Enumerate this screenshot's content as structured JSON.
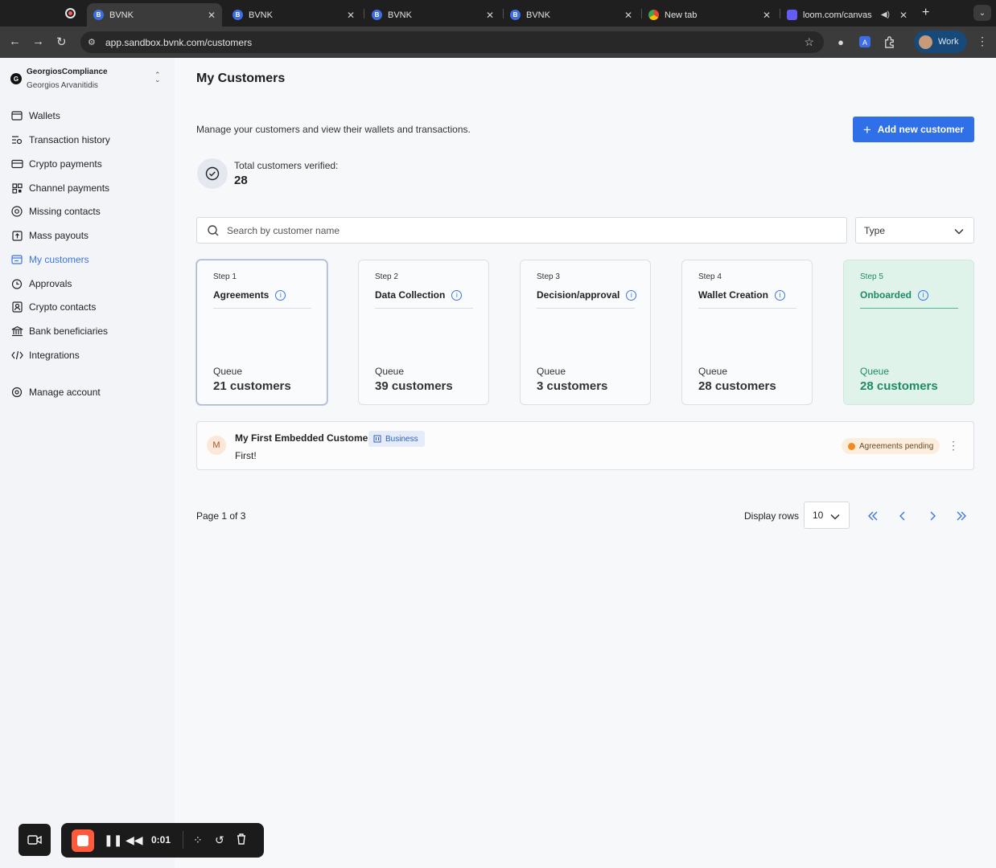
{
  "browser": {
    "tabs": [
      {
        "title": "BVNK",
        "favicon": "B",
        "active": true
      },
      {
        "title": "BVNK",
        "favicon": "B"
      },
      {
        "title": "BVNK",
        "favicon": "B"
      },
      {
        "title": "BVNK",
        "favicon": "B"
      },
      {
        "title": "New tab",
        "favicon": "chrome-icon"
      },
      {
        "title": "loom.com/canvas",
        "favicon": "loom-icon"
      }
    ],
    "url": "app.sandbox.bvnk.com/customers",
    "profile_label": "Work"
  },
  "sidebar": {
    "org_initial": "G",
    "org_name": "GeorgiosCompliance",
    "user_name": "Georgios Arvanitidis",
    "items": [
      {
        "label": "Wallets",
        "icon": "wallet-icon"
      },
      {
        "label": "Transaction history",
        "icon": "transaction-history-icon"
      },
      {
        "label": "Crypto payments",
        "icon": "card-icon"
      },
      {
        "label": "Channel payments",
        "icon": "qr-grid-icon"
      },
      {
        "label": "Missing contacts",
        "icon": "at-sign-icon"
      },
      {
        "label": "Mass payouts",
        "icon": "upload-icon"
      },
      {
        "label": "My customers",
        "icon": "customers-icon",
        "active": true
      },
      {
        "label": "Approvals",
        "icon": "approvals-icon"
      },
      {
        "label": "Crypto contacts",
        "icon": "contact-icon"
      },
      {
        "label": "Bank beneficiaries",
        "icon": "bank-icon"
      },
      {
        "label": "Integrations",
        "icon": "code-icon"
      },
      {
        "label": "Manage account",
        "icon": "gear-icon"
      }
    ]
  },
  "main": {
    "title": "My Customers",
    "subtitle": "Manage your customers and view their wallets and transactions.",
    "add_button": "Add new customer",
    "verified_label": "Total customers verified:",
    "verified_count": "28",
    "search_placeholder": "Search by customer name",
    "type_select": "Type",
    "steps": [
      {
        "step": "Step 1",
        "name": "Agreements",
        "queue_label": "Queue",
        "queue_count": "21 customers"
      },
      {
        "step": "Step 2",
        "name": "Data Collection",
        "queue_label": "Queue",
        "queue_count": "39 customers"
      },
      {
        "step": "Step 3",
        "name": "Decision/approval",
        "queue_label": "Queue",
        "queue_count": "3 customers"
      },
      {
        "step": "Step 4",
        "name": "Wallet Creation",
        "queue_label": "Queue",
        "queue_count": "28 customers"
      },
      {
        "step": "Step 5",
        "name": "Onboarded",
        "queue_label": "Queue",
        "queue_count": "28 customers"
      }
    ],
    "customer": {
      "initial": "M",
      "name": "My First Embedded Customer",
      "badge": "Business",
      "note": "First!",
      "status": "Agreements pending"
    },
    "pagination": {
      "page_info": "Page 1 of 3",
      "rows_label": "Display rows",
      "rows_value": "10"
    }
  },
  "recorder": {
    "time": "0:01"
  },
  "colors": {
    "accent": "#2f6fe8",
    "onboarded_green": "#1f8a66",
    "status_orange": "#f5881f"
  }
}
